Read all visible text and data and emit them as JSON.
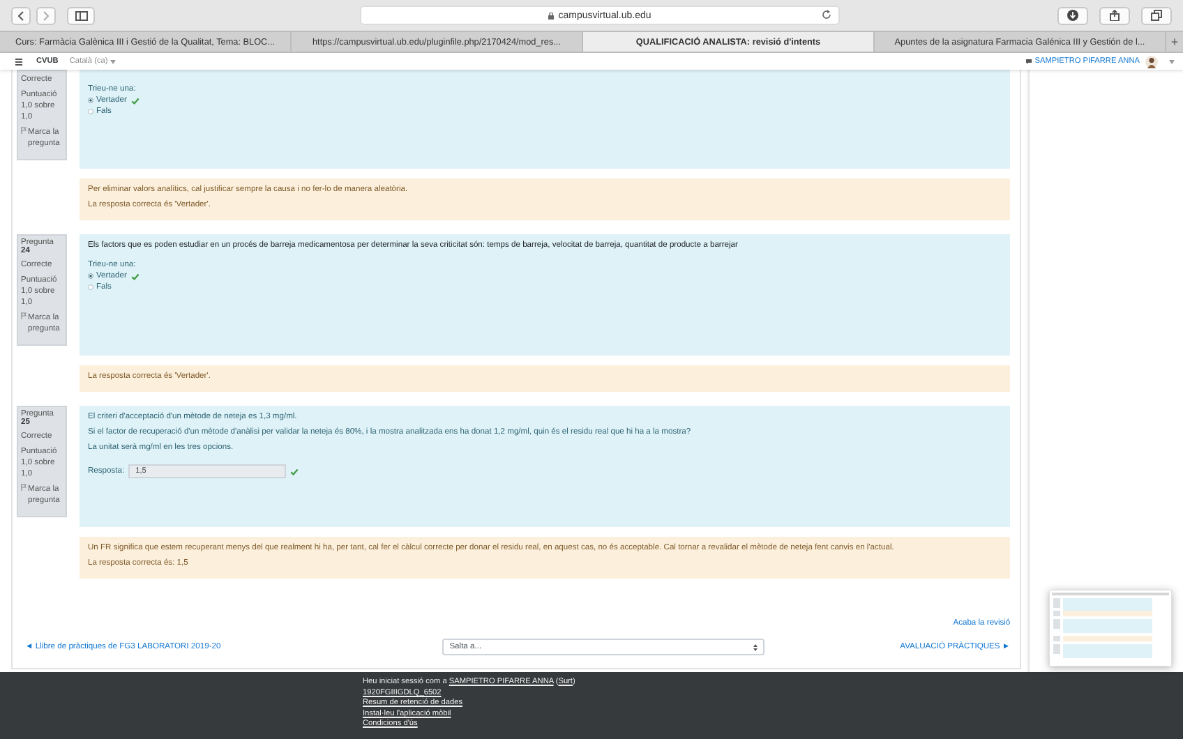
{
  "browser": {
    "address": "campusvirtual.ub.edu",
    "new_tab": "+",
    "tabs": [
      {
        "label": "Curs: Farmàcia Galènica III i Gestió de la Qualitat, Tema: BLOC...",
        "selected": false
      },
      {
        "label": "https://campusvirtual.ub.edu/pluginfile.php/2170424/mod_res...",
        "selected": false
      },
      {
        "label": "QUALIFICACIÓ ANALISTA: revisió d'intents",
        "selected": true
      },
      {
        "label": "Apuntes de la asignatura Farmacia Galénica III y Gestión de l...",
        "selected": false
      }
    ]
  },
  "navbar": {
    "site": "CVUB",
    "language": "Català (ca)",
    "user": "SAMPIETRO PIFARRE ANNA"
  },
  "questions": [
    {
      "kind": "multichoice",
      "status": "Correcte",
      "grade": "Puntuació 1,0 sobre 1,0",
      "flag": "Marca la pregunta",
      "instruction": "Trieu-ne una:",
      "options": [
        {
          "label": "Vertader",
          "selected": true,
          "correct": true
        },
        {
          "label": "Fals",
          "selected": false,
          "correct": false
        }
      ],
      "feedback": [
        "Per eliminar valors analítics, cal justificar sempre la causa i no fer-lo de manera aleatòria.",
        "La resposta correcta és 'Vertader'."
      ]
    },
    {
      "kind": "multichoice",
      "label": "Pregunta",
      "number": "24",
      "status": "Correcte",
      "grade": "Puntuació 1,0 sobre 1,0",
      "flag": "Marca la pregunta",
      "prompt": [
        "Els factors que es poden estudiar en un procés de barreja medicamentosa per determinar la seva criticitat són: temps de barreja, velocitat de barreja, quantitat de producte a barrejar"
      ],
      "instruction": "Trieu-ne una:",
      "options": [
        {
          "label": "Vertader",
          "selected": true,
          "correct": true
        },
        {
          "label": "Fals",
          "selected": false,
          "correct": false
        }
      ],
      "feedback": [
        "La resposta correcta és 'Vertader'."
      ]
    },
    {
      "kind": "shortanswer",
      "label": "Pregunta",
      "number": "25",
      "status": "Correcte",
      "grade": "Puntuació 1,0 sobre 1,0",
      "flag": "Marca la pregunta",
      "prompt": [
        "El criteri d'acceptació d'un mètode de neteja es 1,3 mg/ml.",
        "Si el factor de recuperació d'un mètode d'anàlisi per validar la neteja és 80%, i la mostra analitzada ens ha donat 1,2 mg/ml, quin és el residu real que hi ha a la mostra?",
        "La unitat serà mg/ml en les tres opcions."
      ],
      "answer_label": "Resposta:",
      "answer": "1,5",
      "correct": true,
      "feedback": [
        "Un FR significa que estem recuperant menys del que realment hi ha, per tant, cal fer el càlcul correcte per donar el residu real, en aquest cas, no és acceptable. Cal tornar a revalidar el mètode de neteja fent canvis en l'actual.",
        "La resposta correcta és: 1,5"
      ]
    }
  ],
  "finish_link": "Acaba la revisió",
  "nav": {
    "previous": "◄ Llibre de pràctiques de FG3 LABORATORI 2019-20",
    "jump": "Salta a...",
    "next": "AVALUACIÓ PRÀCTIQUES ►"
  },
  "footer": {
    "prefix": "Heu iniciat sessió com a",
    "user": "SAMPIETRO PIFARRE ANNA",
    "logout_open": "(",
    "logout": "Surt",
    "logout_close": ")",
    "links": [
      "1920FGIIIGDLQ_6502",
      "Resum de retenció de dades",
      "Instal·leu l'aplicació mòbil",
      "Condicions d'ús"
    ]
  }
}
